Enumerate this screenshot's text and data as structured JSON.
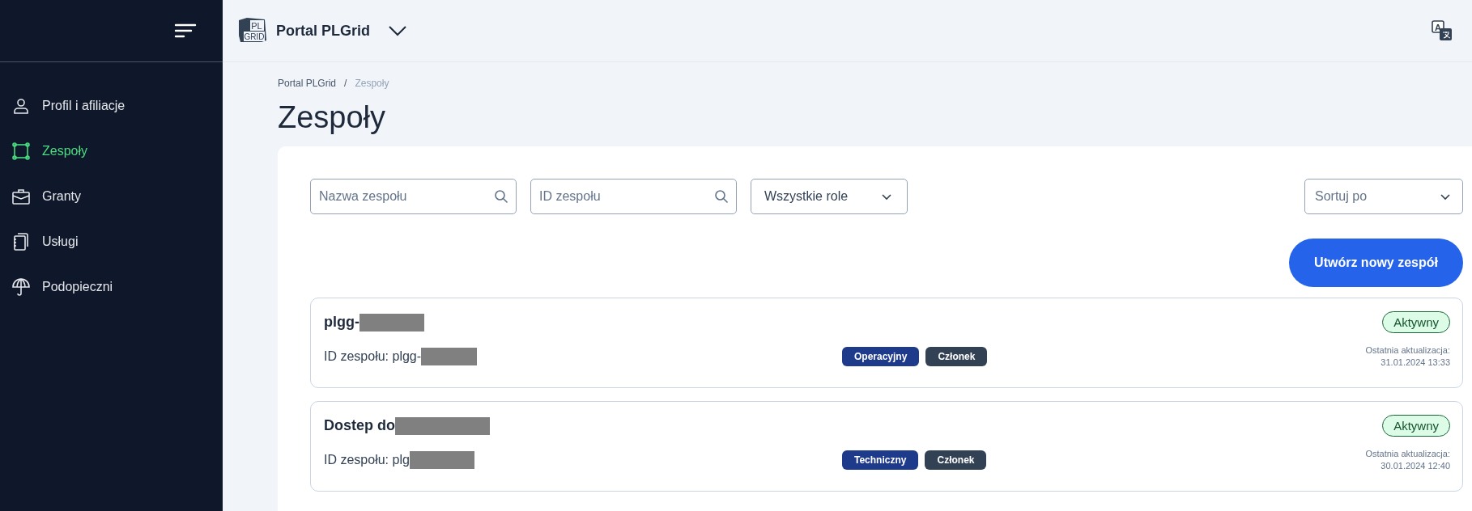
{
  "sidebar": {
    "items": [
      {
        "label": "Profil i afiliacje",
        "kind": "person",
        "selected": false
      },
      {
        "label": "Zespoły",
        "kind": "team",
        "selected": true
      },
      {
        "label": "Granty",
        "kind": "briefcase",
        "selected": false
      },
      {
        "label": "Usługi",
        "kind": "notebook",
        "selected": false
      },
      {
        "label": "Podopieczni",
        "kind": "umbrella",
        "selected": false
      }
    ]
  },
  "header": {
    "logo_text": [
      "PL",
      "GRID"
    ],
    "title": "Portal PLGrid",
    "translate_letter": "A"
  },
  "breadcrumb": [
    {
      "label": "Portal PLGrid",
      "selected": false
    },
    {
      "label": "Zespoły",
      "selected": true
    }
  ],
  "breadcrumb_separator": "/",
  "page_title": "Zespoły",
  "filters": {
    "name": {
      "placeholder": "Nazwa zespołu"
    },
    "id": {
      "placeholder": "ID zespołu"
    },
    "role": {
      "value": "Wszystkie role"
    },
    "sort": {
      "placeholder": "Sortuj po"
    }
  },
  "create_button": "Utwórz nowy zespół",
  "teams": [
    {
      "name": "plgg-",
      "name_redacted": true,
      "id_label": "ID zespołu: plgg-",
      "id_redacted": true,
      "tags": [
        {
          "label": "Operacyjny",
          "kind": "type"
        },
        {
          "label": "Członek",
          "kind": "role"
        }
      ],
      "status": "Aktywny",
      "updated_label": "Ostatnia aktualizacja:",
      "updated": "31.01.2024 13:33"
    },
    {
      "name": "Dostep do ",
      "name_redacted": true,
      "id_label": "ID zespołu: plg",
      "id_redacted": true,
      "tags": [
        {
          "label": "Techniczny",
          "kind": "type"
        },
        {
          "label": "Członek",
          "kind": "role"
        }
      ],
      "status": "Aktywny",
      "updated_label": "Ostatnia aktualizacja:",
      "updated": "30.01.2024 12:40"
    }
  ]
}
